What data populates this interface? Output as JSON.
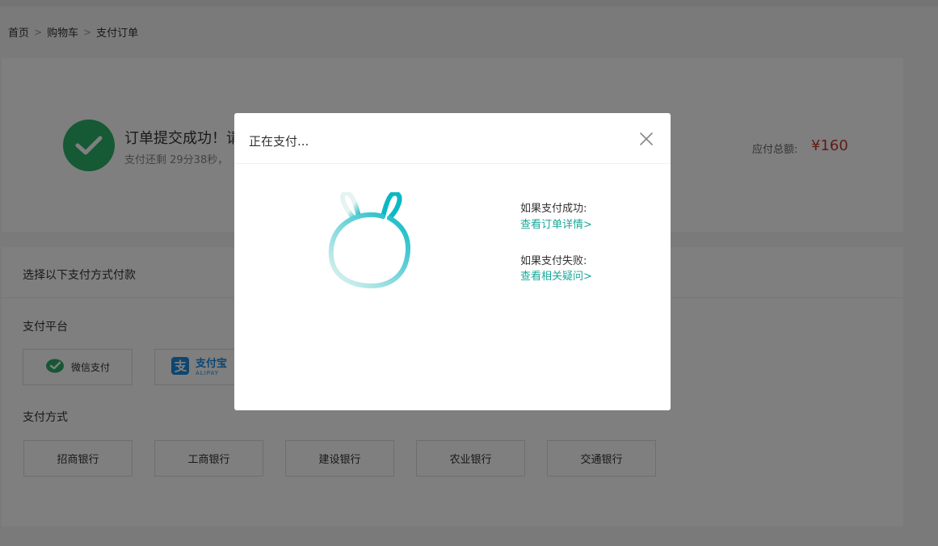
{
  "breadcrumb": {
    "home": "首页",
    "cart": "购物车",
    "current": "支付订单",
    "separator": ">"
  },
  "order": {
    "title": "订单提交成功！请",
    "countdown": "支付还剩 29分38秒，",
    "amount_label": "应付总额:",
    "amount_value": "¥160"
  },
  "payment": {
    "heading": "选择以下支付方式付款",
    "platform_label": "支付平台",
    "wechat_label": "微信支付",
    "alipay_label": "支付宝",
    "alipay_sub": "ALIPAY",
    "methods_label": "支付方式",
    "banks": [
      "招商银行",
      "工商银行",
      "建设银行",
      "农业银行",
      "交通银行"
    ]
  },
  "modal": {
    "title": "正在支付...",
    "success_label": "如果支付成功:",
    "success_link": "查看订单详情>",
    "fail_label": "如果支付失败:",
    "fail_link": "查看相关疑问>"
  },
  "colors": {
    "success_green": "#2db36a",
    "price_red": "#c0392b",
    "link_teal": "#19a89a",
    "wechat_green": "#2aae67",
    "alipay_blue": "#1a8ce0"
  },
  "icons": [
    "check-icon",
    "close-icon",
    "wechat-icon",
    "alipay-icon",
    "rabbit-loading-icon"
  ]
}
